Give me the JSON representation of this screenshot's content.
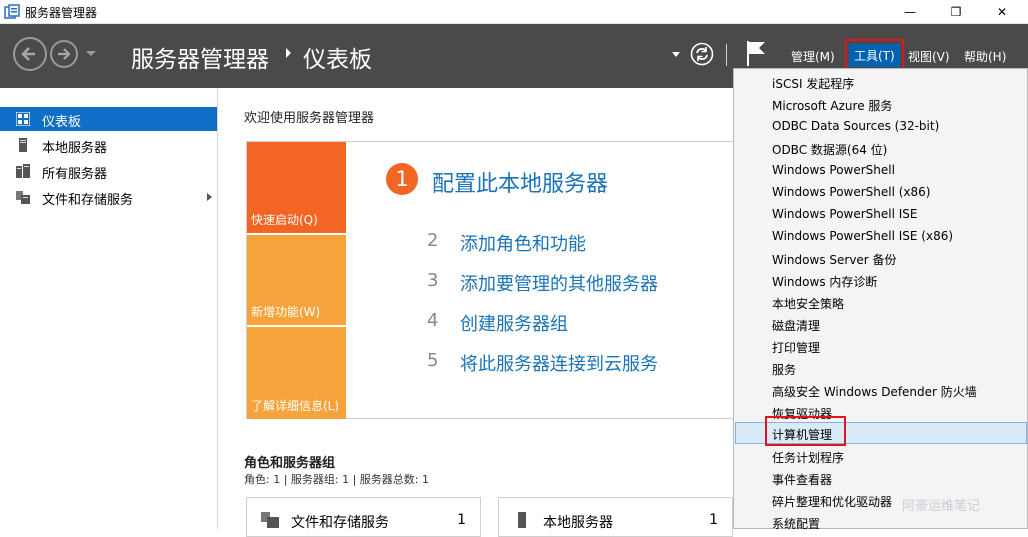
{
  "window": {
    "title": "服务器管理器",
    "minimize": "—",
    "maximize": "❐",
    "close": "✕"
  },
  "header": {
    "breadcrumb_root": "服务器管理器",
    "breadcrumb_page": "仪表板",
    "menus": [
      "管理(M)",
      "工具(T)",
      "视图(V)",
      "帮助(H)"
    ],
    "active_menu": "工具(T)"
  },
  "sidebar": {
    "items": [
      {
        "label": "仪表板",
        "icon": "dashboard-icon",
        "selected": true
      },
      {
        "label": "本地服务器",
        "icon": "server-icon",
        "selected": false
      },
      {
        "label": "所有服务器",
        "icon": "servers-icon",
        "selected": false
      },
      {
        "label": "文件和存储服务",
        "icon": "storage-icon",
        "selected": false,
        "expandable": true
      }
    ]
  },
  "welcome": {
    "title": "欢迎使用服务器管理器",
    "tiles": [
      "快速启动(Q)",
      "新增功能(W)",
      "了解详细信息(L)"
    ],
    "steps": [
      {
        "num": "1",
        "text": "配置此本地服务器"
      },
      {
        "num": "2",
        "text": "添加角色和功能"
      },
      {
        "num": "3",
        "text": "添加要管理的其他服务器"
      },
      {
        "num": "4",
        "text": "创建服务器组"
      },
      {
        "num": "5",
        "text": "将此服务器连接到云服务"
      }
    ]
  },
  "roles": {
    "title": "角色和服务器组",
    "summary": "角色: 1 | 服务器组: 1 | 服务器总数: 1",
    "cards": [
      {
        "name": "文件和存储服务",
        "count": "1"
      },
      {
        "name": "本地服务器",
        "count": "1"
      }
    ]
  },
  "tools_menu": {
    "items": [
      "iSCSI 发起程序",
      "Microsoft Azure 服务",
      "ODBC Data Sources (32-bit)",
      "ODBC 数据源(64 位)",
      "Windows PowerShell",
      "Windows PowerShell (x86)",
      "Windows PowerShell ISE",
      "Windows PowerShell ISE (x86)",
      "Windows Server 备份",
      "Windows 内存诊断",
      "本地安全策略",
      "磁盘清理",
      "打印管理",
      "服务",
      "高级安全 Windows Defender 防火墙",
      "恢复驱动器",
      "计算机管理",
      "任务计划程序",
      "事件查看器",
      "碎片整理和优化驱动器",
      "系统配置"
    ],
    "highlighted": "计算机管理"
  },
  "watermark": "阿豪运维笔记",
  "colors": {
    "header_bg": "#4a4a4a",
    "selected_blue": "#0f6fc6",
    "active_menu_blue": "#0063b1",
    "quick_start_orange": "#f26522",
    "tile_orange": "#f5a33a",
    "link_blue": "#1a73b8",
    "annotation_red": "#e0141e"
  }
}
